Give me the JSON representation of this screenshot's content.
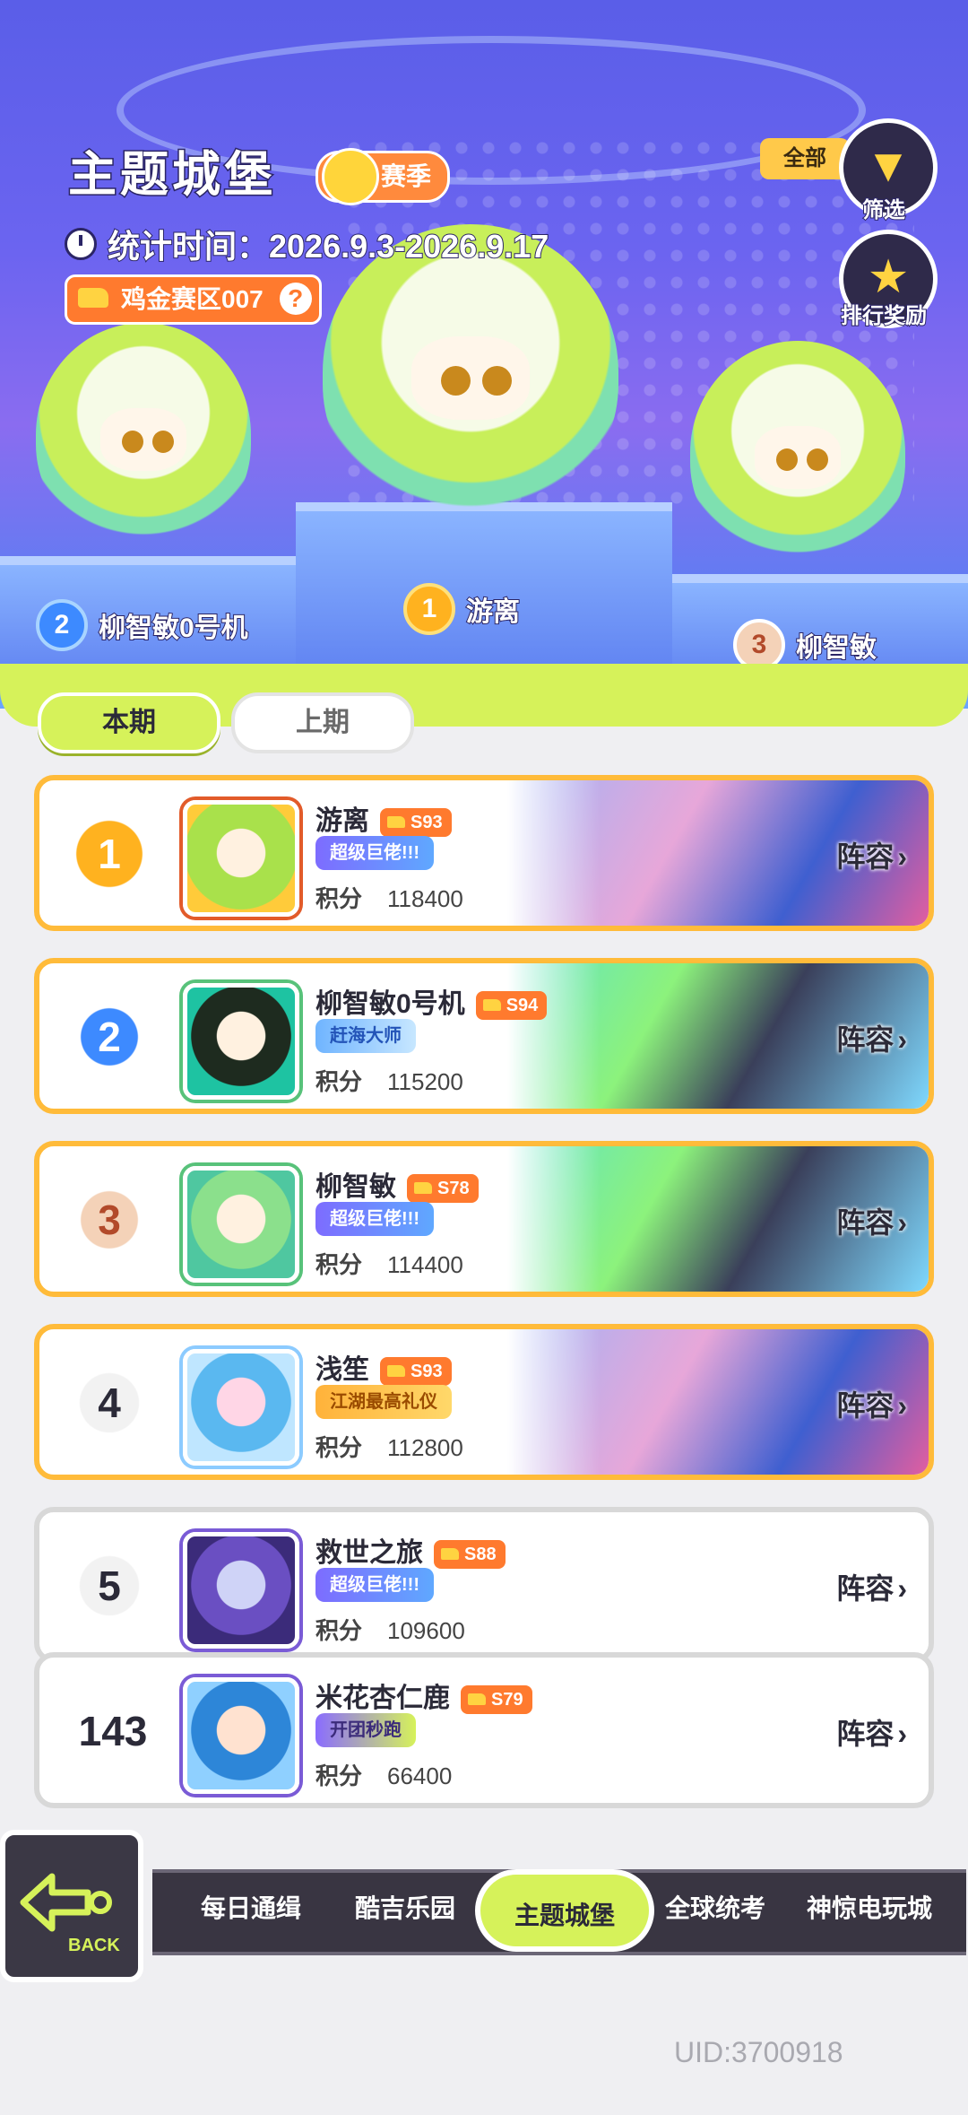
{
  "header": {
    "title": "主题城堡",
    "season_label": "赛季",
    "stat_time": "统计时间：2026.9.3-2026.9.17",
    "region": "鸡金赛区007",
    "filter_all": "全部",
    "filter_label": "筛选",
    "reward_label": "排行奖励"
  },
  "podium": [
    {
      "rank": "1",
      "name": "游离"
    },
    {
      "rank": "2",
      "name": "柳智敏0号机"
    },
    {
      "rank": "3",
      "name": "柳智敏"
    }
  ],
  "period_tabs": {
    "current": "本期",
    "previous": "上期"
  },
  "rows": [
    {
      "rank": "1",
      "name": "游离",
      "season": "S93",
      "title": "超级巨佬!!!",
      "score_label": "积分",
      "score": "118400",
      "lineup": "阵容"
    },
    {
      "rank": "2",
      "name": "柳智敏0号机",
      "season": "S94",
      "title": "赶海大师",
      "score_label": "积分",
      "score": "115200",
      "lineup": "阵容"
    },
    {
      "rank": "3",
      "name": "柳智敏",
      "season": "S78",
      "title": "超级巨佬!!!",
      "score_label": "积分",
      "score": "114400",
      "lineup": "阵容"
    },
    {
      "rank": "4",
      "name": "浅笙",
      "season": "S93",
      "title": "江湖最高礼仪",
      "score_label": "积分",
      "score": "112800",
      "lineup": "阵容"
    },
    {
      "rank": "5",
      "name": "救世之旅",
      "season": "S88",
      "title": "超级巨佬!!!",
      "score_label": "积分",
      "score": "109600",
      "lineup": "阵容"
    },
    {
      "rank": "143",
      "name": "米花杏仁鹿",
      "season": "S79",
      "title": "开团秒跑",
      "score_label": "积分",
      "score": "66400",
      "lineup": "阵容"
    }
  ],
  "bottom_nav": {
    "back": "BACK",
    "items": [
      "每日通缉",
      "酷吉乐园",
      "主题城堡",
      "全球统考",
      "神惊电玩城"
    ],
    "active": "主题城堡"
  },
  "uid": "UID:3700918",
  "colors": {
    "accent": "#d6f25a",
    "gold_border": "#ffbb3a",
    "badge_orange": "#ff7a2e",
    "hero_bg": "#6b64f0"
  }
}
